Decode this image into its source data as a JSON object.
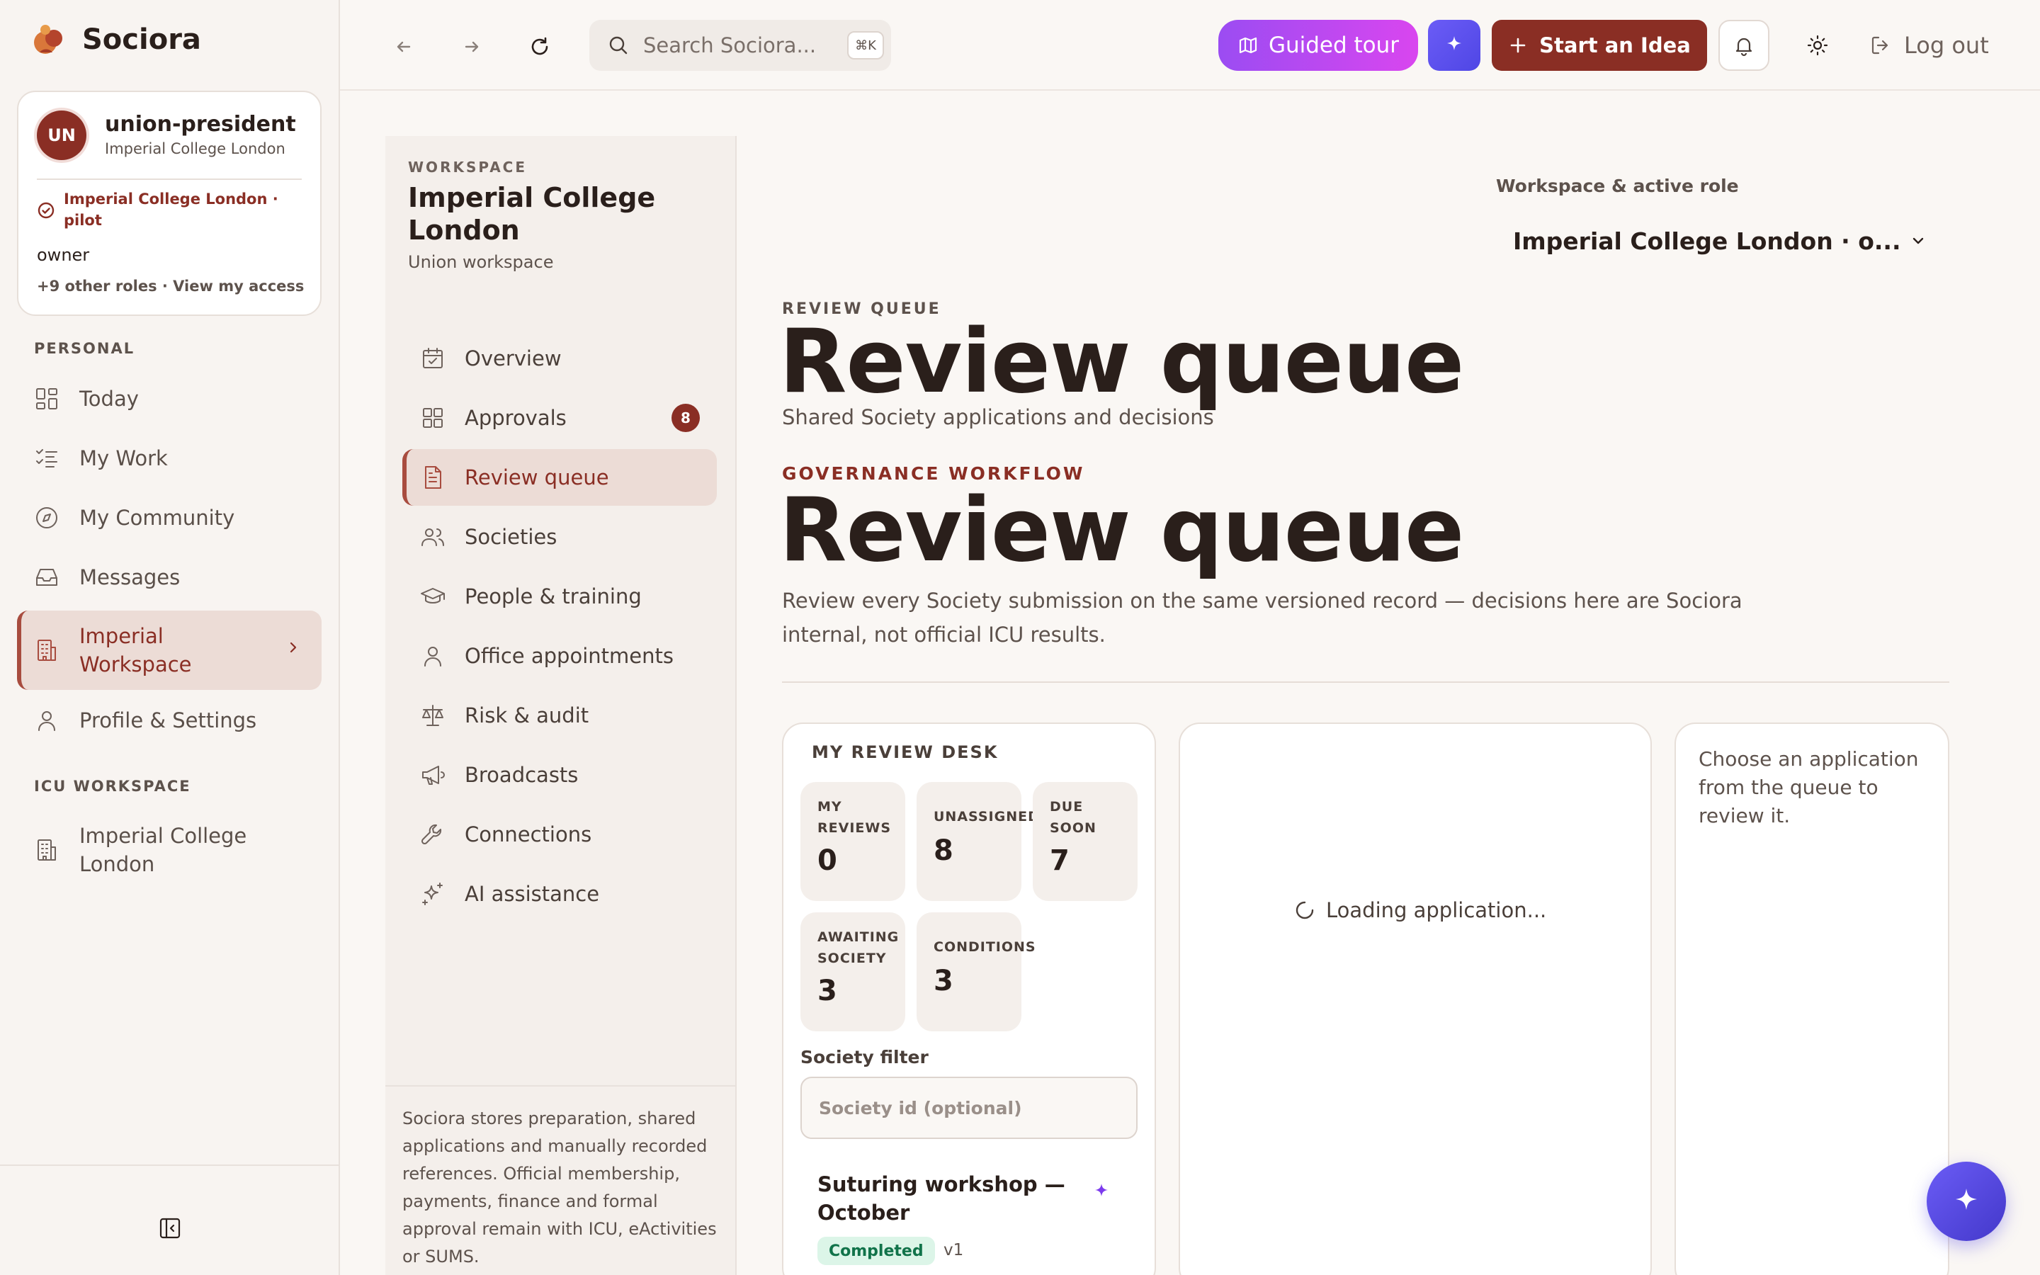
{
  "brand": {
    "name": "Sociora"
  },
  "user": {
    "initials": "UN",
    "name": "union-president",
    "org": "Imperial College London",
    "pilot": "Imperial College London · pilot",
    "role": "owner",
    "more": "+9 other roles · View my access"
  },
  "sidebar": {
    "personal_label": "PERSONAL",
    "items": [
      {
        "label": "Today",
        "icon": "dashboard-icon"
      },
      {
        "label": "My Work",
        "icon": "list-checks-icon"
      },
      {
        "label": "My Community",
        "icon": "compass-icon"
      },
      {
        "label": "Messages",
        "icon": "inbox-icon"
      },
      {
        "label": "Imperial Workspace",
        "icon": "building-icon"
      },
      {
        "label": "Profile & Settings",
        "icon": "user-icon"
      }
    ],
    "icu_label": "ICU WORKSPACE",
    "icu_items": [
      {
        "label": "Imperial College London",
        "icon": "building-icon"
      }
    ]
  },
  "topbar": {
    "search_placeholder": "Search Sociora...",
    "search_shortcut": "⌘K",
    "guided_tour": "Guided tour",
    "start_idea": "Start an Idea",
    "logout": "Log out"
  },
  "workspace": {
    "eyebrow": "WORKSPACE",
    "title": "Imperial College London",
    "subtitle": "Union workspace",
    "nav": [
      {
        "label": "Overview",
        "icon": "calendar-check-icon"
      },
      {
        "label": "Approvals",
        "icon": "dashboard-icon",
        "badge": "8"
      },
      {
        "label": "Review queue",
        "icon": "file-text-icon"
      },
      {
        "label": "Societies",
        "icon": "users-icon"
      },
      {
        "label": "People & training",
        "icon": "graduation-cap-icon"
      },
      {
        "label": "Office appointments",
        "icon": "user-icon"
      },
      {
        "label": "Risk & audit",
        "icon": "scale-icon"
      },
      {
        "label": "Broadcasts",
        "icon": "megaphone-icon"
      },
      {
        "label": "Connections",
        "icon": "wrench-icon"
      },
      {
        "label": "AI assistance",
        "icon": "sparkles-icon"
      }
    ],
    "footer": "Sociora stores preparation, shared applications and manually recorded references. Official membership, payments, finance and formal approval remain with ICU, eActivities or SUMS."
  },
  "main": {
    "role_label": "Workspace & active role",
    "role_value": "Imperial College London · o...",
    "eyebrow1": "REVIEW QUEUE",
    "title1": "Review queue",
    "subtitle1": "Shared Society applications and decisions",
    "eyebrow2": "GOVERNANCE WORKFLOW",
    "title2": "Review queue",
    "description": "Review every Society submission on the same versioned record — decisions here are Sociora internal, not official ICU results."
  },
  "desk": {
    "title": "MY REVIEW DESK",
    "stats": [
      {
        "label": "MY REVIEWS",
        "value": "0"
      },
      {
        "label": "UNASSIGNED",
        "value": "8"
      },
      {
        "label": "DUE SOON",
        "value": "7"
      },
      {
        "label": "AWAITING SOCIETY",
        "value": "3"
      },
      {
        "label": "CONDITIONS",
        "value": "3"
      }
    ],
    "filter_label": "Society filter",
    "filter_placeholder": "Society id (optional)",
    "application": {
      "title": "Suturing workshop — October",
      "status": "Completed",
      "version": "v1"
    }
  },
  "loading_text": "Loading application...",
  "detail_text": "Choose an application from the queue to review it.",
  "colors": {
    "accent": "#8a2e24",
    "tour_start": "#9b4cf2",
    "tour_end": "#d946ef",
    "ai": "#4f46e5",
    "status_green": "#11734a"
  }
}
